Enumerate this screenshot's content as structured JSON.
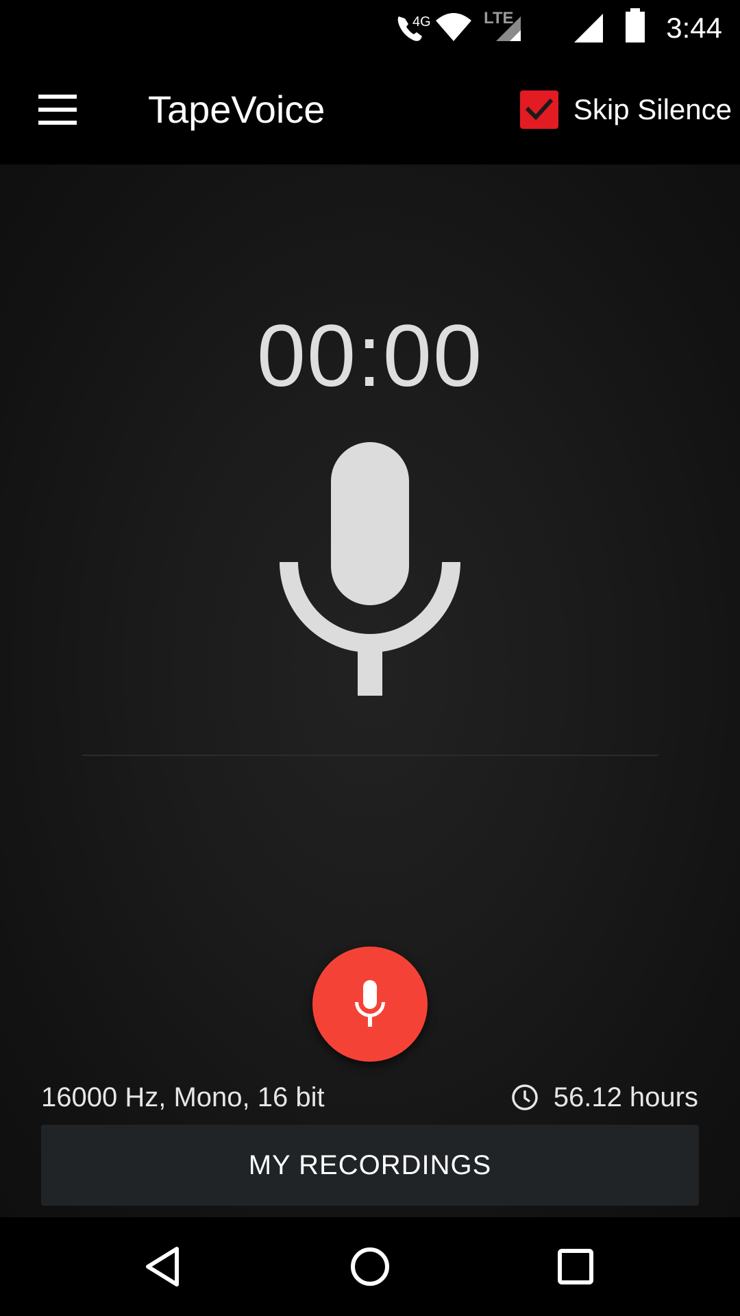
{
  "status_bar": {
    "time": "3:44",
    "icons": [
      "wifi-calling-icon",
      "wifi-icon",
      "lte-signal-icon",
      "cell-signal-icon",
      "battery-icon"
    ],
    "network_label": "4G",
    "lte_label": "LTE"
  },
  "app_bar": {
    "title": "TapeVoice",
    "skip_silence_label": "Skip Silence",
    "skip_silence_checked": true,
    "menu_icon": "hamburger-menu-icon"
  },
  "recorder": {
    "timer": "00:00",
    "mic_icon": "microphone-icon",
    "format_info": "16000 Hz, Mono, 16 bit",
    "remaining_time": "56.12 hours",
    "remaining_icon": "clock-icon",
    "recordings_button_label": "MY RECORDINGS"
  },
  "nav_bar": {
    "buttons": [
      "back-icon",
      "home-icon",
      "recents-icon"
    ]
  },
  "colors": {
    "accent_red": "#f44336",
    "checkbox_red": "#e31b23",
    "background": "#000000",
    "button_dark": "#212427",
    "text_light": "#e6e6e6"
  }
}
